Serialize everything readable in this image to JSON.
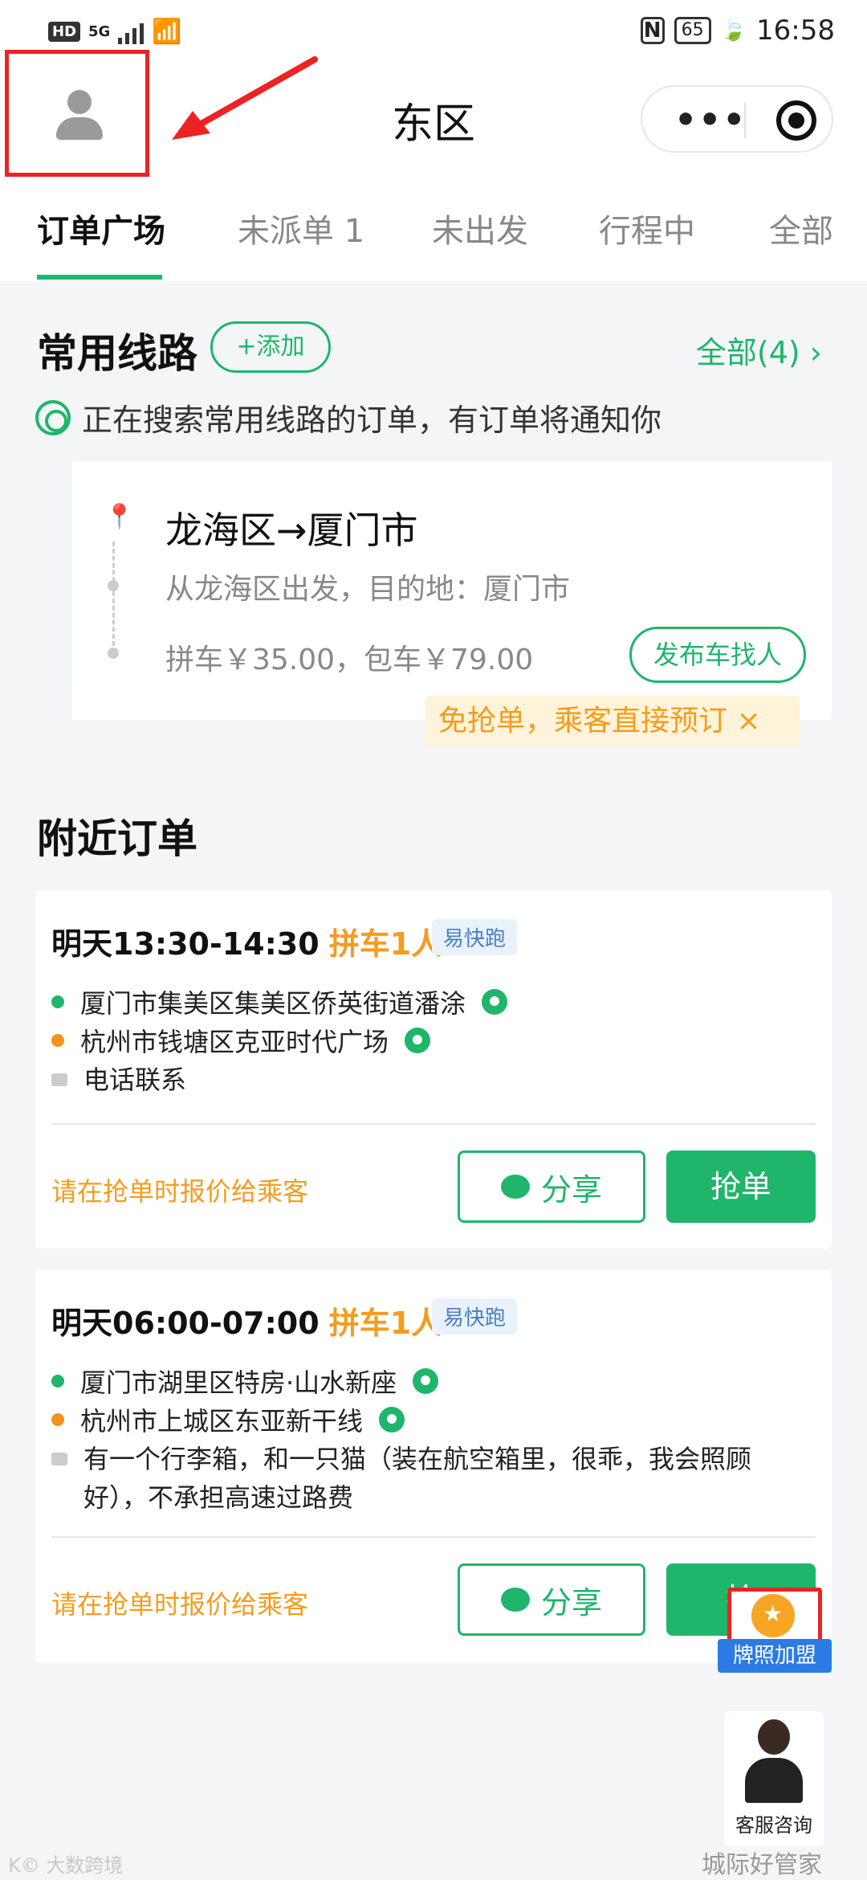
{
  "status_bar": {
    "hd": "HD",
    "network": "5G",
    "nfc": "N",
    "battery": "65",
    "time": "16:58"
  },
  "header": {
    "title": "东区",
    "more": "•••"
  },
  "tabs": [
    {
      "label": "订单广场",
      "active": true
    },
    {
      "label": "未派单 1",
      "active": false
    },
    {
      "label": "未出发",
      "active": false
    },
    {
      "label": "行程中",
      "active": false
    },
    {
      "label": "全部",
      "active": false
    }
  ],
  "routes": {
    "title": "常用线路",
    "add_label": "+添加",
    "all_label": "全部(4) ›",
    "notice": "正在搜索常用线路的订单，有订单将通知你",
    "card": {
      "name": "龙海区→厦门市",
      "desc": "从龙海区出发，目的地：厦门市",
      "price": "拼车￥35.00，包车￥79.00",
      "publish_label": "发布车找人"
    },
    "tip": "免抢单，乘客直接预订 ×"
  },
  "nearby": {
    "title": "附近订单",
    "orders": [
      {
        "time": "明天13:30-14:30",
        "type": "拼车1人",
        "tag": "易快跑",
        "from": "厦门市集美区集美区侨英街道潘涂",
        "to": "杭州市钱塘区克亚时代广场",
        "note": "电话联系",
        "hint": "请在抢单时报价给乘客",
        "share_label": "分享",
        "grab_label": "抢单"
      },
      {
        "time": "明天06:00-07:00",
        "type": "拼车1人",
        "tag": "易快跑",
        "from": "厦门市湖里区特房·山水新座",
        "to": "杭州市上城区东亚新干线",
        "note": "有一个行李箱，和一只猫（装在航空箱里，很乖，我会照顾好），不承担高速过路费",
        "hint": "请在抢单时报价给乘客",
        "share_label": "分享",
        "grab_label": "抢"
      }
    ]
  },
  "badge": {
    "label": "牌照加盟"
  },
  "customer_service": {
    "label": "客服咨询"
  },
  "watermarks": {
    "left": "K© 大数跨境",
    "right": "城际好管家"
  },
  "colors": {
    "accent": "#1fb56b",
    "warning": "#f39c1f",
    "highlight": "#e22222"
  }
}
